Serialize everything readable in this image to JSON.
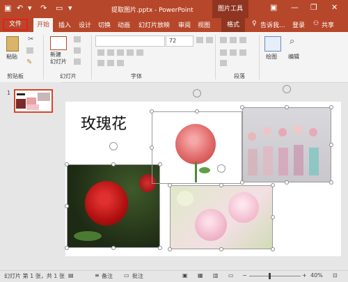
{
  "titlebar": {
    "doc_title": "提取图片.pptx - PowerPoint",
    "context_tool": "图片工具"
  },
  "tabs": {
    "file": "文件",
    "home": "开始",
    "insert": "插入",
    "design": "设计",
    "transitions": "切换",
    "animations": "动画",
    "slideshow": "幻灯片放映",
    "review": "审阅",
    "view": "视图",
    "format": "格式",
    "tell_me": "告诉我...",
    "sign_in": "登录",
    "share": "共享"
  },
  "ribbon": {
    "paste": "粘贴",
    "new_slide": "新建\n幻灯片",
    "font_size": "72",
    "drawing": "绘图",
    "editing": "编辑",
    "groups": {
      "clipboard": "剪贴板",
      "slides": "幻灯片",
      "font": "字体",
      "paragraph": "段落"
    }
  },
  "thumbs": {
    "slide_number": "1"
  },
  "slide": {
    "title": "玫瑰花"
  },
  "status": {
    "slide_info": "幻灯片 第 1 张，共 1 张",
    "notes": "备注",
    "comments": "批注",
    "zoom": "40%"
  },
  "colors": {
    "accent": "#b7472a",
    "context": "#8f3520",
    "selection_outline": "#e81e1e"
  }
}
